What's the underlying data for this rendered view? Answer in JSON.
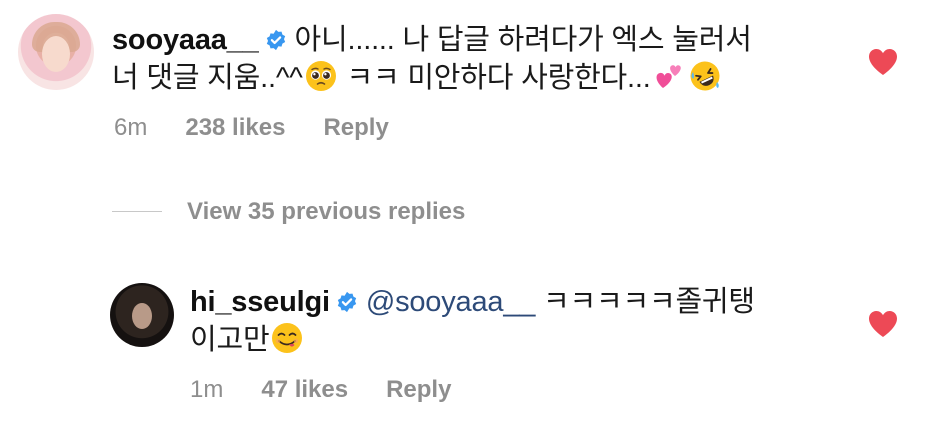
{
  "comments": [
    {
      "username": "sooyaaa__",
      "line1": "아니...... 나 답글 하려다가 엑스 눌러서",
      "line2_pre": "너 댓글 지움..^^",
      "line2_mid": " ㅋㅋ 미안하다 사랑한다...",
      "time": "6m",
      "likes": "238 likes",
      "reply": "Reply"
    },
    {
      "username": "hi_sseulgi",
      "mention": "@sooyaaa__",
      "line1_text": " ㅋㅋㅋㅋㅋ졸귀탱",
      "line2": "이고만",
      "time": "1m",
      "likes": "47 likes",
      "reply": "Reply"
    }
  ],
  "view_replies": "View 35 previous replies",
  "colors": {
    "heart": "#ed4956",
    "verified": "#3897f0",
    "meta": "#8e8e8e",
    "mention": "#2d4a78"
  },
  "icons": [
    "heart-icon",
    "verified-badge-icon",
    "pleading-face-emoji",
    "two-hearts-emoji",
    "rofl-emoji",
    "yum-face-emoji"
  ]
}
